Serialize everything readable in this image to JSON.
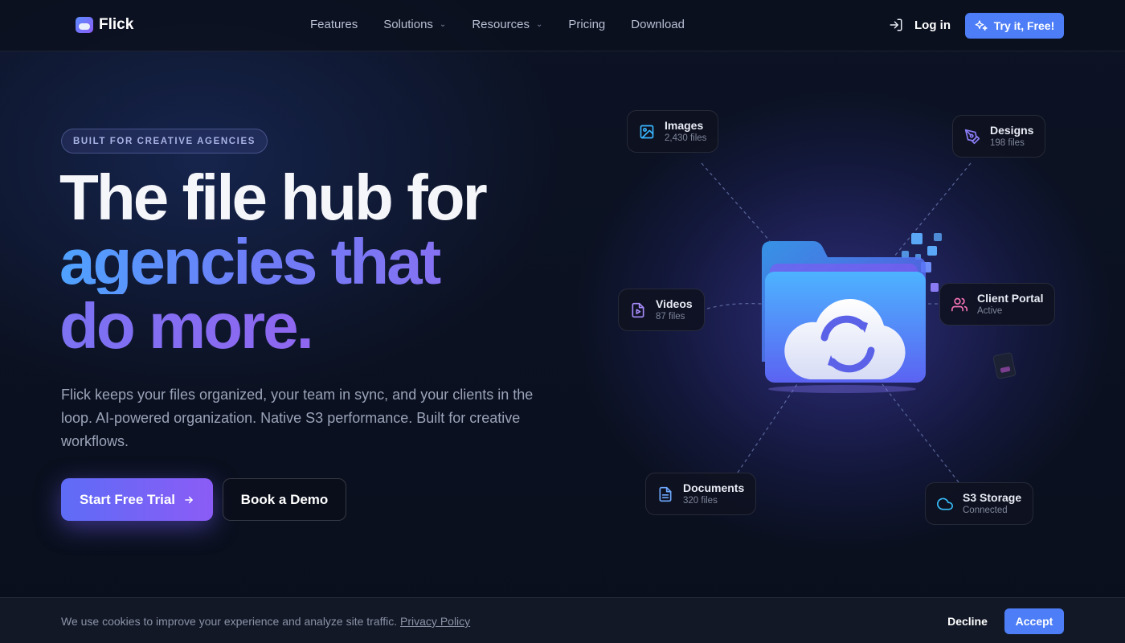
{
  "nav": {
    "brand": "Flick",
    "menu": [
      {
        "label": "Features"
      },
      {
        "label": "Solutions"
      },
      {
        "label": "Resources"
      },
      {
        "label": "Pricing"
      },
      {
        "label": "Download"
      }
    ],
    "login_label": "Log in",
    "cta_label": "Try it, Free!"
  },
  "hero": {
    "badge": "BUILT FOR CREATIVE AGENCIES",
    "headline_line1": "The file hub for",
    "headline_line2": "agencies that",
    "headline_line3": "do more.",
    "lead": "Flick keeps your files organized, your team in sync, and your clients in the loop. AI-powered organization. Native S3 performance. Built for creative workflows.",
    "primary_cta": "Start Free Trial",
    "secondary_cta": "Book a Demo"
  },
  "diagram": {
    "nodes": [
      {
        "title": "Images",
        "subtitle": "2,430 files",
        "icon": "image-icon",
        "color": "#38b6ff"
      },
      {
        "title": "Designs",
        "subtitle": "198 files",
        "icon": "pen-tool-icon",
        "color": "#8b7cf6"
      },
      {
        "title": "Videos",
        "subtitle": "87 files",
        "icon": "video-file-icon",
        "color": "#a78bfa"
      },
      {
        "title": "Client Portal",
        "subtitle": "Active",
        "icon": "users-icon",
        "color": "#f472b6"
      },
      {
        "title": "Documents",
        "subtitle": "320 files",
        "icon": "document-icon",
        "color": "#6ea8fe"
      },
      {
        "title": "S3 Storage",
        "subtitle": "Connected",
        "icon": "cloud-icon",
        "color": "#38bdf8"
      }
    ]
  },
  "cookie": {
    "text": "We use cookies to improve your experience and analyze site traffic.",
    "link": "Privacy Policy",
    "decline": "Decline",
    "accept": "Accept"
  },
  "colors": {
    "accent": "#4d7ef7",
    "gradient_start": "#4fa2ff",
    "gradient_end": "#9d5ff0",
    "background": "#0a0f1d"
  }
}
